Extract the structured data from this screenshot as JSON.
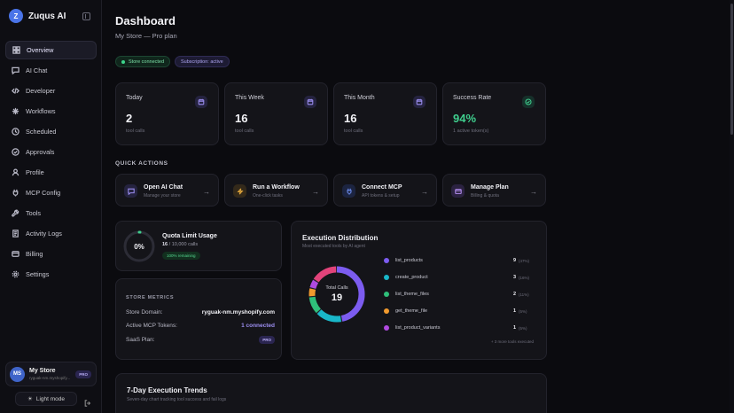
{
  "brand": {
    "logo_letter": "Z",
    "name": "Zuqus AI"
  },
  "sidebar": {
    "items": [
      {
        "label": "Overview",
        "icon": "grid-icon",
        "active": true
      },
      {
        "label": "AI Chat",
        "icon": "chat-icon"
      },
      {
        "label": "Developer",
        "icon": "code-icon"
      },
      {
        "label": "Workflows",
        "icon": "workflow-icon"
      },
      {
        "label": "Scheduled",
        "icon": "clock-icon"
      },
      {
        "label": "Approvals",
        "icon": "check-circle-icon"
      },
      {
        "label": "Profile",
        "icon": "user-icon"
      },
      {
        "label": "MCP Config",
        "icon": "plug-icon"
      },
      {
        "label": "Tools",
        "icon": "wrench-icon"
      },
      {
        "label": "Activity Logs",
        "icon": "log-icon"
      },
      {
        "label": "Billing",
        "icon": "card-icon"
      },
      {
        "label": "Settings",
        "icon": "gear-icon"
      }
    ],
    "store": {
      "initials": "MS",
      "name": "My Store",
      "domain": "ryguak-nm.myshopify...",
      "plan_badge": "PRO"
    },
    "theme_button": "Light mode"
  },
  "header": {
    "title": "Dashboard",
    "subtitle": "My Store — Pro plan",
    "badges": {
      "status": "Store connected",
      "subscription": "Subscription: active"
    }
  },
  "stats": [
    {
      "label": "Today",
      "value": "2",
      "sub": "tool calls",
      "icon": "calendar-icon"
    },
    {
      "label": "This Week",
      "value": "16",
      "sub": "tool calls",
      "icon": "calendar-icon"
    },
    {
      "label": "This Month",
      "value": "16",
      "sub": "tool calls",
      "icon": "calendar-icon"
    },
    {
      "label": "Success Rate",
      "value": "94%",
      "sub": "1 active token(s)",
      "icon": "check-circle-icon"
    }
  ],
  "quick_actions": {
    "title": "QUICK ACTIONS",
    "items": [
      {
        "title": "Open AI Chat",
        "sub": "Manage your store",
        "icon": "chat-icon",
        "color": "#9c8ef0",
        "bg": "#25233f"
      },
      {
        "title": "Run a Workflow",
        "sub": "One-click tasks",
        "icon": "bolt-icon",
        "color": "#e0a53a",
        "bg": "#33291a"
      },
      {
        "title": "Connect MCP",
        "sub": "API tokens & setup",
        "icon": "plug-icon",
        "color": "#6d8df0",
        "bg": "#1c2440"
      },
      {
        "title": "Manage Plan",
        "sub": "Billing & quota",
        "icon": "card-icon",
        "color": "#b48ef0",
        "bg": "#2b2240"
      }
    ]
  },
  "quota": {
    "percent": "0%",
    "fraction": 0.0,
    "title": "Quota Limit Usage",
    "used": "16",
    "limit_text": "/ 10,000 calls",
    "remaining": "100% remaining"
  },
  "store_metrics": {
    "title": "STORE METRICS",
    "rows": [
      {
        "key": "Store Domain:",
        "value": "ryguak-nm.myshopify.com"
      },
      {
        "key": "Active MCP Tokens:",
        "value": "1 connected"
      },
      {
        "key": "SaaS Plan:",
        "value": "PRO"
      }
    ]
  },
  "execution_distribution": {
    "title": "Execution Distribution",
    "subtitle": "Most executed tools by AI agent",
    "total_label": "Total Calls",
    "total": "19",
    "more": "+ 3 more tools executed",
    "items": [
      {
        "name": "list_products",
        "count": "9",
        "pct": "(47%)",
        "color": "#7c5cf0"
      },
      {
        "name": "create_product",
        "count": "3",
        "pct": "(16%)",
        "color": "#19b7c9"
      },
      {
        "name": "list_theme_files",
        "count": "2",
        "pct": "(11%)",
        "color": "#2fbf7a"
      },
      {
        "name": "get_theme_file",
        "count": "1",
        "pct": "(5%)",
        "color": "#f29a2e"
      },
      {
        "name": "list_product_variants",
        "count": "1",
        "pct": "(5%)",
        "color": "#b04ae0"
      }
    ],
    "rest_color": "#e2437a"
  },
  "trends": {
    "title": "7-Day Execution Trends",
    "subtitle": "Seven-day chart tracking tool success and fail logs"
  }
}
